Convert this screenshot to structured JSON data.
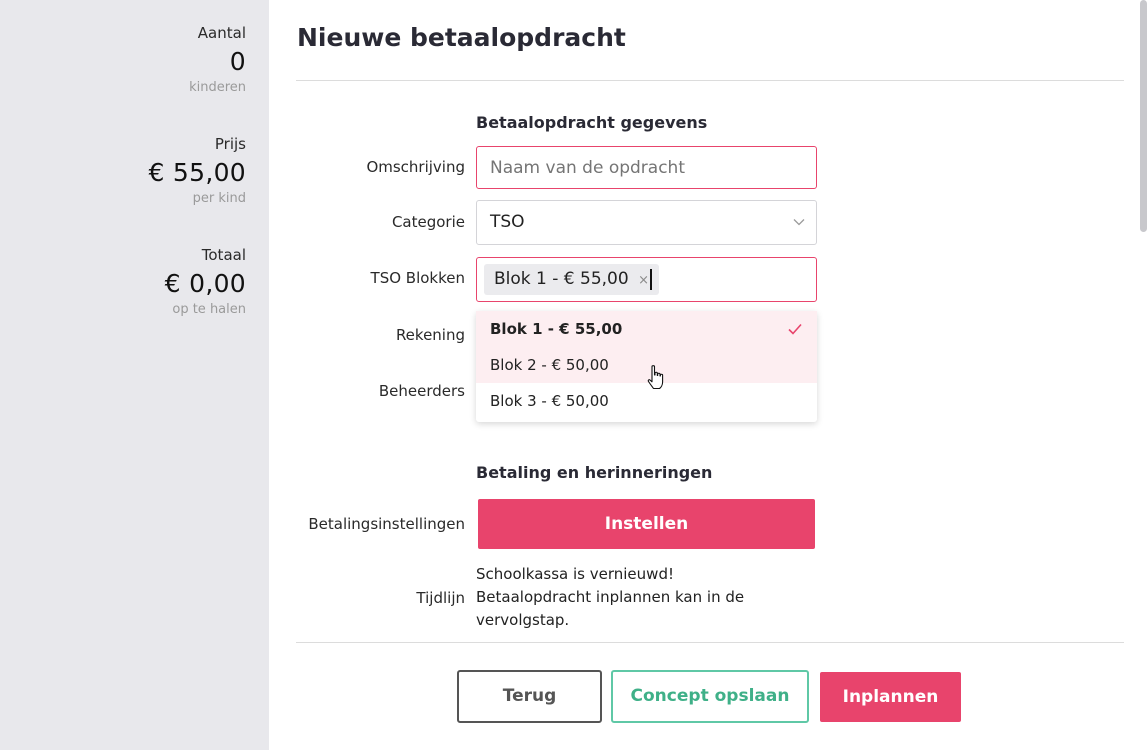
{
  "sidebar": {
    "aantal": {
      "label": "Aantal",
      "value": "0",
      "sub": "kinderen"
    },
    "prijs": {
      "label": "Prijs",
      "value": "€ 55,00",
      "sub": "per kind"
    },
    "totaal": {
      "label": "Totaal",
      "value": "€ 0,00",
      "sub": "op te halen"
    }
  },
  "page": {
    "title": "Nieuwe betaalopdracht"
  },
  "form": {
    "section1_title": "Betaalopdracht gegevens",
    "omschrijving": {
      "label": "Omschrijving",
      "value": "",
      "placeholder": "Naam van de opdracht"
    },
    "categorie": {
      "label": "Categorie",
      "value": "TSO"
    },
    "tso_blokken": {
      "label": "TSO Blokken",
      "selected_chip": "Blok 1 - € 55,00",
      "chip_remove": "×",
      "options": [
        {
          "label": "Blok 1 - € 55,00",
          "selected": true
        },
        {
          "label": "Blok 2 - € 50,00",
          "selected": false,
          "hovered": true
        },
        {
          "label": "Blok 3 - € 50,00",
          "selected": false
        }
      ]
    },
    "rekening": {
      "label": "Rekening"
    },
    "beheerders": {
      "label": "Beheerders"
    },
    "section2_title": "Betaling en herinneringen",
    "betalingsinstellingen": {
      "label": "Betalingsinstellingen",
      "button": "Instellen"
    },
    "tijdlijn": {
      "label": "Tijdlijn",
      "lines": [
        "Schoolkassa is vernieuwd!",
        "Betaalopdracht inplannen kan in de",
        "vervolgstap."
      ]
    }
  },
  "footer": {
    "back": "Terug",
    "save_concept": "Concept opslaan",
    "schedule": "Inplannen"
  },
  "colors": {
    "accent": "#e8446c",
    "accent_light": "#fdeef1",
    "green": "#5fc8a6",
    "sidebar_bg": "#e8e8ec"
  },
  "icons": {
    "dropdown": "chevron-down-icon",
    "check": "check-icon",
    "remove": "close-icon",
    "cursor": "hand-pointer-icon"
  }
}
